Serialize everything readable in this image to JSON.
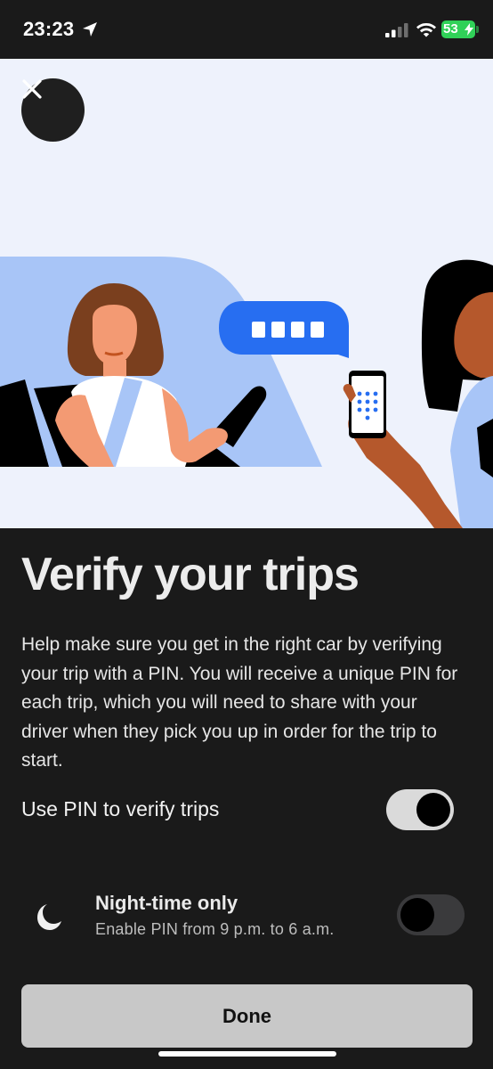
{
  "status_bar": {
    "time": "23:23",
    "battery": "53",
    "icons": [
      "location-arrow-icon",
      "signal-icon",
      "wifi-icon",
      "battery-charging-icon"
    ]
  },
  "hero": {
    "close_icon": "close-icon",
    "illustration": "driver-and-rider-pin-illustration"
  },
  "main": {
    "title": "Verify your trips",
    "description": "Help make sure you get in the right car by verifying your trip with a PIN. You will receive a unique PIN for each trip, which you will need to share with your driver when they pick you up in order for the trip to start.",
    "pin_toggle": {
      "label": "Use PIN to verify trips",
      "on": true
    },
    "night_option": {
      "icon": "moon-icon",
      "title": "Night-time only",
      "subtitle": "Enable PIN from 9 p.m. to 6 a.m.",
      "on": false
    },
    "done_label": "Done"
  },
  "colors": {
    "background": "#1a1a1a",
    "hero_background": "#eef2fc",
    "accent_blue": "#276ef1",
    "toggle_on": "#dadada",
    "toggle_off": "#3a3a3c",
    "button": "#c8c8c8",
    "battery": "#30d158"
  }
}
